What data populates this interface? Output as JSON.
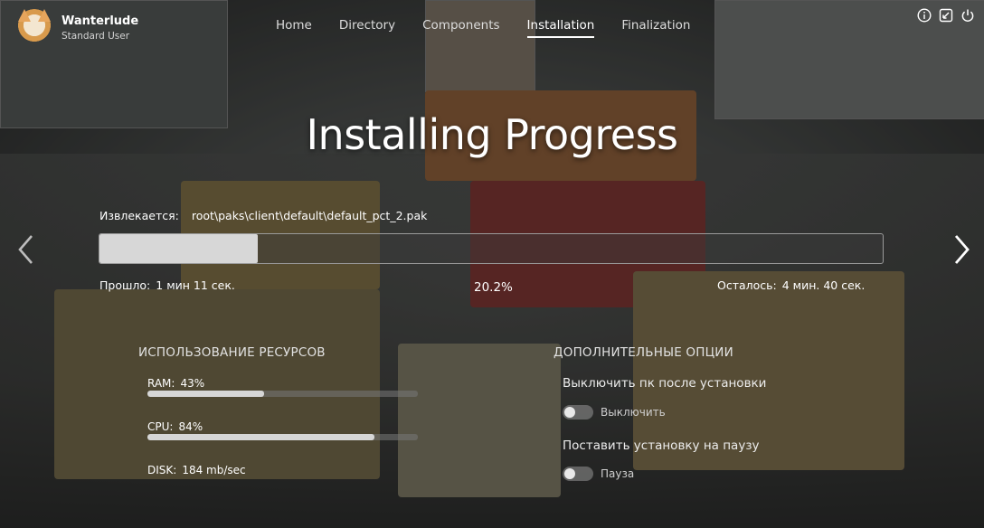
{
  "header": {
    "user_name": "Wanterlude",
    "user_role": "Standard User",
    "nav": [
      {
        "label": "Home",
        "active": false
      },
      {
        "label": "Directory",
        "active": false
      },
      {
        "label": "Components",
        "active": false
      },
      {
        "label": "Installation",
        "active": true
      },
      {
        "label": "Finalization",
        "active": false
      }
    ],
    "icons": [
      "info-icon",
      "minimize-icon",
      "power-icon"
    ]
  },
  "title": "Installing Progress",
  "extract": {
    "label": "Извлекается:",
    "path": "root\\paks\\client\\default\\default_pct_2.pak"
  },
  "progress": {
    "percent": 20.2,
    "percent_text": "20.2%",
    "elapsed_label": "Прошло:",
    "elapsed_value": "1 мин 11 сек.",
    "remaining_label": "Осталось:",
    "remaining_value": "4 мин. 40 сек."
  },
  "resources": {
    "title": "ИСПОЛЬЗОВАНИЕ РЕСУРСОВ",
    "ram": {
      "label": "RAM:",
      "value": "43%",
      "fraction": 0.43
    },
    "cpu": {
      "label": "CPU:",
      "value": "84%",
      "fraction": 0.84
    },
    "disk": {
      "label": "DISK:",
      "value": "184 mb/sec"
    }
  },
  "options": {
    "title": "ДОПОЛНИТЕЛЬНЫЕ ОПЦИИ",
    "shutdown": {
      "label": "Выключить пк после установки",
      "toggle_text": "Выключить",
      "on": false
    },
    "pause": {
      "label": "Поставить установку на паузу",
      "toggle_text": "Пауза",
      "on": false
    }
  },
  "colors": {
    "accent": "#ffffff",
    "progress_fill": "#d7d7d7",
    "track": "#787878"
  }
}
